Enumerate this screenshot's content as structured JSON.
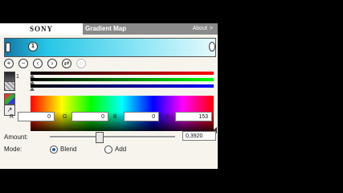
{
  "header": {
    "brand": "SONY",
    "title": "Gradient Map",
    "about": "About",
    "about_chevron": ">"
  },
  "gradient": {
    "selected_stop": "1",
    "colors": [
      "#1578a6",
      "#26c6e6",
      "#8fe6f6",
      "#e6fafc"
    ]
  },
  "toolbar": {
    "icons": [
      "add-stop-icon",
      "remove-stop-icon",
      "previous-stop-icon",
      "next-stop-icon",
      "reverse-icon",
      "settings-icon"
    ]
  },
  "swatch": {
    "label": "1"
  },
  "color": {
    "r_label": "R",
    "r": "0",
    "g_label": "G",
    "g": "0",
    "b_label": "B",
    "b": "0",
    "a_label": "A",
    "a": "153"
  },
  "amount": {
    "label": "Amount:",
    "value": "0,3920"
  },
  "mode": {
    "label": "Mode:",
    "options": [
      "Blend",
      "Add"
    ],
    "selected": "Blend"
  }
}
